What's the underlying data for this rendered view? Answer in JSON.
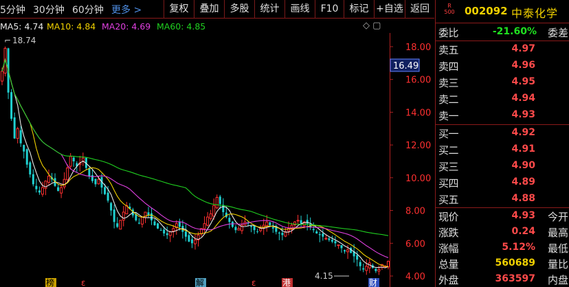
{
  "toolbar": {
    "periods": [
      "5分钟",
      "30分钟",
      "60分钟"
    ],
    "more": "更多 >",
    "buttons": [
      "复权",
      "叠加",
      "多股",
      "统计",
      "画线",
      "F10",
      "标记",
      "+自选",
      "返回"
    ]
  },
  "ma_legend": [
    {
      "label": "MA5: 4.74",
      "color": "#e8e8e8"
    },
    {
      "label": "MA10: 4.84",
      "color": "#f0d000"
    },
    {
      "label": "MA20: 4.69",
      "color": "#e040e0"
    },
    {
      "label": "MA60: 4.85",
      "color": "#20d020"
    }
  ],
  "chart_data": {
    "type": "candlestick",
    "y_ticks": [
      "18.00",
      "16.00",
      "14.00",
      "12.00",
      "10.00",
      "8.00",
      "6.00",
      "4.00"
    ],
    "ylim": [
      4.0,
      18.0
    ],
    "current_price_label": "16.49",
    "high_annotation": "18.74",
    "low_annotation": "4.15",
    "markers": [
      "榜",
      "解",
      "港",
      "财"
    ],
    "close_series": [
      16.5,
      17.9,
      15.2,
      13.6,
      12.4,
      13.0,
      12.1,
      11.6,
      10.8,
      10.2,
      9.6,
      9.3,
      9.1,
      9.4,
      9.8,
      10.1,
      9.9,
      9.5,
      9.2,
      9.4,
      9.9,
      10.6,
      11.3,
      11.0,
      10.7,
      10.9,
      11.2,
      10.6,
      10.1,
      9.8,
      9.6,
      9.9,
      9.4,
      9.0,
      8.6,
      8.0,
      7.3,
      7.0,
      7.4,
      7.9,
      8.3,
      8.1,
      7.7,
      7.4,
      7.2,
      7.6,
      7.9,
      7.7,
      7.4,
      7.1,
      6.9,
      6.8,
      6.6,
      6.5,
      6.7,
      6.9,
      7.2,
      7.0,
      6.7,
      6.4,
      6.1,
      6.0,
      6.2,
      6.5,
      6.9,
      7.2,
      7.6,
      7.8,
      8.3,
      8.8,
      8.4,
      7.9,
      7.6,
      7.3,
      7.0,
      6.8,
      6.9,
      7.1,
      7.3,
      7.2,
      7.0,
      6.8,
      6.7,
      6.9,
      7.1,
      7.3,
      7.1,
      6.9,
      6.7,
      6.6,
      6.5,
      6.7,
      6.9,
      7.1,
      7.3,
      7.4,
      7.2,
      7.3,
      7.2,
      7.0,
      6.8,
      6.6,
      6.5,
      6.4,
      6.3,
      6.2,
      6.1,
      6.0,
      5.9,
      5.7,
      5.5,
      5.6,
      5.4,
      5.2,
      5.0,
      4.6,
      4.4,
      4.6,
      4.8,
      4.5,
      4.3,
      4.4,
      4.7,
      4.6,
      4.9
    ]
  },
  "panel": {
    "badge_r": "R",
    "badge_num": "500",
    "code": "002092",
    "name": "中泰化学",
    "weibi_label": "委比",
    "weibi_value": "-21.60%",
    "weicha_label": "委差",
    "sell": [
      {
        "label": "卖五",
        "price": "4.97"
      },
      {
        "label": "卖四",
        "price": "4.96"
      },
      {
        "label": "卖三",
        "price": "4.95"
      },
      {
        "label": "卖二",
        "price": "4.94"
      },
      {
        "label": "卖一",
        "price": "4.93"
      }
    ],
    "buy": [
      {
        "label": "买一",
        "price": "4.92"
      },
      {
        "label": "买二",
        "price": "4.91"
      },
      {
        "label": "买三",
        "price": "4.90"
      },
      {
        "label": "买四",
        "price": "4.89"
      },
      {
        "label": "买五",
        "price": "4.88"
      }
    ],
    "quote": [
      {
        "label": "现价",
        "value": "4.93",
        "label2": "今开",
        "color": "#ff4a4a"
      },
      {
        "label": "涨跌",
        "value": "0.24",
        "label2": "最高",
        "color": "#ff4a4a"
      },
      {
        "label": "涨幅",
        "value": "5.12%",
        "label2": "最低",
        "color": "#ff4a4a"
      },
      {
        "label": "总量",
        "value": "560689",
        "label2": "量比",
        "color": "#f0d000"
      },
      {
        "label": "外盘",
        "value": "363597",
        "label2": "内盘",
        "color": "#ff4a4a"
      }
    ]
  }
}
